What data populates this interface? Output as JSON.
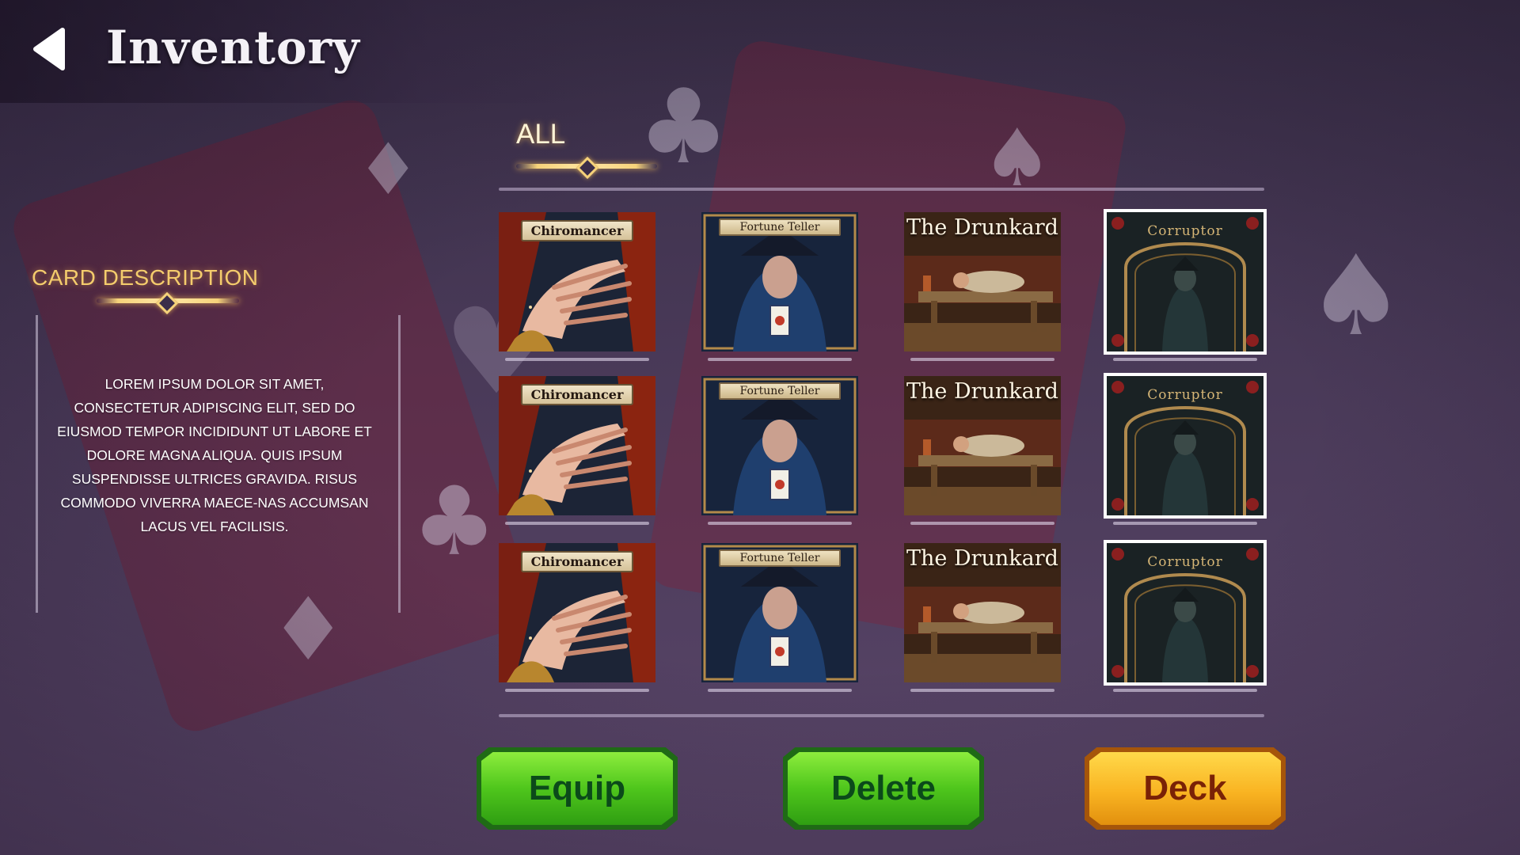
{
  "header": {
    "title": "Inventory",
    "back_icon": "back-arrow-icon"
  },
  "tabs": [
    {
      "label": "ALL",
      "active": true
    }
  ],
  "description": {
    "heading": "CARD DESCRIPTION",
    "text": "LOREM IPSUM DOLOR SIT AMET, CONSECTETUR ADIPISCING ELIT, SED DO EIUSMOD TEMPOR INCIDIDUNT UT LABORE ET DOLORE MAGNA ALIQUA. QUIS IPSUM SUSPENDISSE ULTRICES GRAVIDA. RISUS COMMODO VIVERRA MAECE-NAS ACCUMSAN LACUS VEL FACILISIS."
  },
  "cards": [
    [
      {
        "name": "Chiromancer",
        "art": "chiromancer"
      },
      {
        "name": "Fortune Teller",
        "art": "fortune-teller"
      },
      {
        "name": "The Drunkard",
        "art": "drunkard"
      },
      {
        "name": "Corruptor",
        "art": "corruptor",
        "selected": true
      }
    ],
    [
      {
        "name": "Chiromancer",
        "art": "chiromancer"
      },
      {
        "name": "Fortune Teller",
        "art": "fortune-teller"
      },
      {
        "name": "The Drunkard",
        "art": "drunkard"
      },
      {
        "name": "Corruptor",
        "art": "corruptor",
        "selected": true
      }
    ],
    [
      {
        "name": "Chiromancer",
        "art": "chiromancer"
      },
      {
        "name": "Fortune Teller",
        "art": "fortune-teller"
      },
      {
        "name": "The Drunkard",
        "art": "drunkard"
      },
      {
        "name": "Corruptor",
        "art": "corruptor",
        "selected": true
      }
    ]
  ],
  "buttons": {
    "equip": "Equip",
    "delete": "Delete",
    "deck": "Deck"
  },
  "colors": {
    "accent_gold": "#f4cc6c",
    "button_green": "#4fc61c",
    "button_gold": "#f9b422",
    "background": "#4a3a59"
  }
}
